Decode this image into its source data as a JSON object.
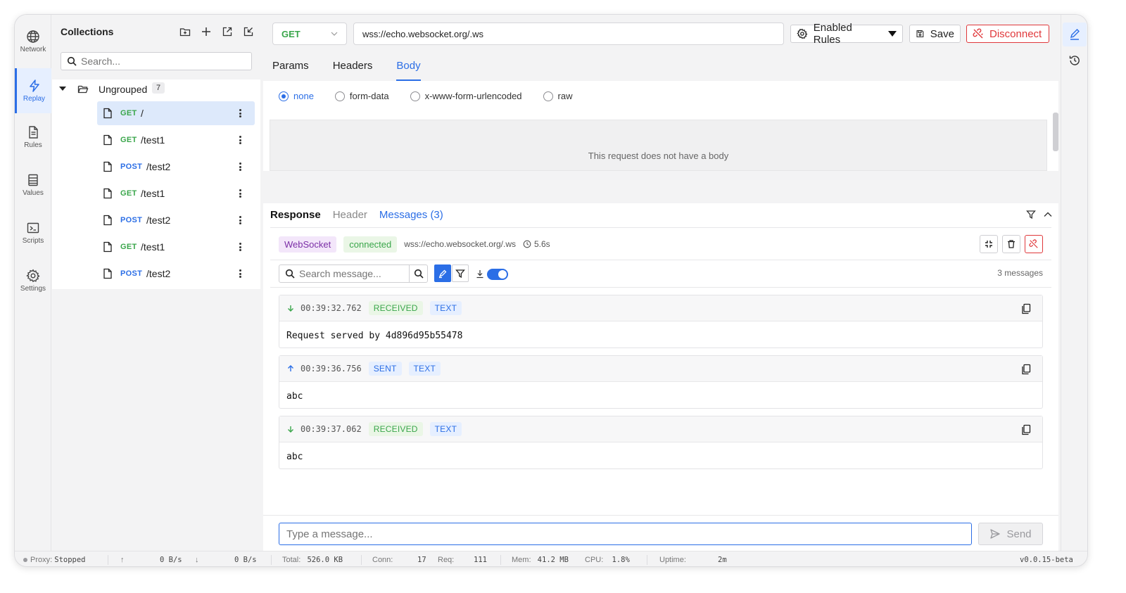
{
  "rail": {
    "items": [
      {
        "label": "Network",
        "icon": "globe-icon"
      },
      {
        "label": "Replay",
        "icon": "lightning-icon",
        "active": true
      },
      {
        "label": "Rules",
        "icon": "document-icon"
      },
      {
        "label": "Values",
        "icon": "table-icon"
      },
      {
        "label": "Scripts",
        "icon": "terminal-icon"
      },
      {
        "label": "Settings",
        "icon": "gear-icon"
      }
    ]
  },
  "collections": {
    "title": "Collections",
    "search_placeholder": "Search...",
    "group": {
      "label": "Ungrouped",
      "count": "7"
    },
    "requests": [
      {
        "method": "GET",
        "path": "/",
        "selected": true
      },
      {
        "method": "GET",
        "path": "/test1"
      },
      {
        "method": "POST",
        "path": "/test2"
      },
      {
        "method": "GET",
        "path": "/test1"
      },
      {
        "method": "POST",
        "path": "/test2"
      },
      {
        "method": "GET",
        "path": "/test1"
      },
      {
        "method": "POST",
        "path": "/test2"
      }
    ]
  },
  "request": {
    "method": "GET",
    "url": "wss://echo.websocket.org/.ws",
    "rules_label": "Enabled Rules",
    "save_label": "Save",
    "disconnect_label": "Disconnect",
    "tabs": [
      "Params",
      "Headers",
      "Body"
    ],
    "active_tab": "Body",
    "body_types": [
      "none",
      "form-data",
      "x-www-form-urlencoded",
      "raw"
    ],
    "body_type_selected": "none",
    "empty_body_text": "This request does not have a body"
  },
  "response": {
    "tabs": [
      "Response",
      "Header",
      "Messages (3)"
    ],
    "protocol_badge": "WebSocket",
    "status_badge": "connected",
    "url": "wss://echo.websocket.org/.ws",
    "duration": "5.6s",
    "search_placeholder": "Search message...",
    "count_label": "3 messages",
    "messages": [
      {
        "direction": "RECEIVED",
        "time": "00:39:32.762",
        "type": "TEXT",
        "body": "Request served by 4d896d95b55478"
      },
      {
        "direction": "SENT",
        "time": "00:39:36.756",
        "type": "TEXT",
        "body": "abc"
      },
      {
        "direction": "RECEIVED",
        "time": "00:39:37.062",
        "type": "TEXT",
        "body": "abc"
      }
    ],
    "composer_placeholder": "Type a message...",
    "send_label": "Send"
  },
  "status_bar": {
    "proxy_label": "Proxy:",
    "proxy_value": "Stopped",
    "up_rate": "0 B/s",
    "down_rate": "0 B/s",
    "total_label": "Total:",
    "total_value": "526.0 KB",
    "conn_label": "Conn:",
    "conn_value": "17",
    "req_label": "Req:",
    "req_value": "111",
    "mem_label": "Mem:",
    "mem_value": "41.2 MB",
    "cpu_label": "CPU:",
    "cpu_value": "1.8%",
    "uptime_label": "Uptime:",
    "uptime_value": "2m",
    "version": "v0.0.15-beta"
  },
  "colors": {
    "accent": "#2b6ee6",
    "get": "#3aa64b",
    "post": "#2b6ee6",
    "danger": "#e0383b",
    "websocket": "#7b2ea6"
  }
}
